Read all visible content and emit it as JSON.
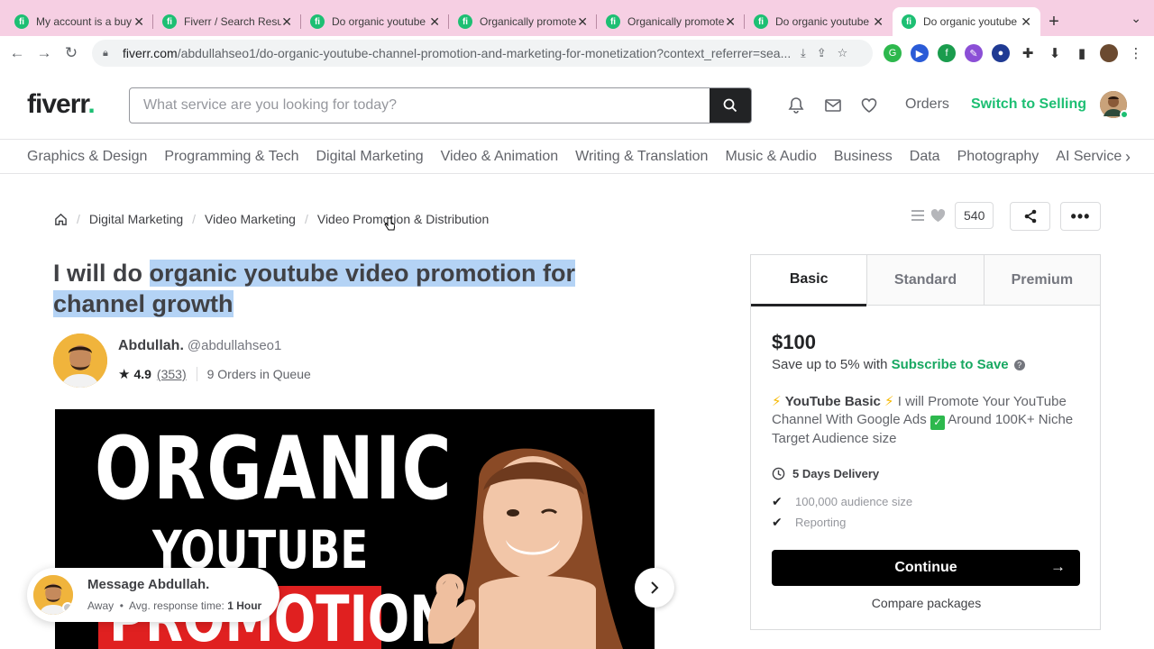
{
  "browser": {
    "tabs": [
      {
        "title": "My account is a buy"
      },
      {
        "title": "Fiverr / Search Resu"
      },
      {
        "title": "Do organic youtube"
      },
      {
        "title": "Organically promote"
      },
      {
        "title": "Organically promote"
      },
      {
        "title": "Do organic youtube"
      },
      {
        "title": "Do organic youtube"
      }
    ],
    "url_host": "fiverr.com",
    "url_path": "/abdullahseo1/do-organic-youtube-channel-promotion-and-marketing-for-monetization?context_referrer=sea..."
  },
  "header": {
    "logo": "fiverr",
    "search_placeholder": "What service are you looking for today?",
    "orders": "Orders",
    "switch": "Switch to Selling"
  },
  "categories": [
    "Graphics & Design",
    "Programming & Tech",
    "Digital Marketing",
    "Video & Animation",
    "Writing & Translation",
    "Music & Audio",
    "Business",
    "Data",
    "Photography",
    "AI Services"
  ],
  "breadcrumb": [
    "Digital Marketing",
    "Video Marketing",
    "Video Promotion & Distribution"
  ],
  "likes_count": "540",
  "gig": {
    "title_prefix": "I will do ",
    "title_highlight": "organic youtube video promotion for channel growth",
    "image_line1": "ORGANIC",
    "image_line2": "YOUTUBE",
    "image_line3": "PROMOTION"
  },
  "seller": {
    "name": "Abdullah.",
    "handle": "@abdullahseo1",
    "rating": "4.9",
    "reviews": "(353)",
    "queue": "9 Orders in Queue"
  },
  "message": {
    "title": "Message Abdullah.",
    "status": "Away",
    "response_label": "Avg. response time:",
    "response_time": "1 Hour"
  },
  "package": {
    "tabs": [
      "Basic",
      "Standard",
      "Premium"
    ],
    "price": "$100",
    "save_text": "Save up to 5% with",
    "save_link": "Subscribe to Save",
    "desc_title": "YouTube Basic",
    "desc_body": "I will Promote Your YouTube Channel With Google Ads",
    "desc_tail": "Around 100K+ Niche Target Audience size",
    "delivery": "5 Days Delivery",
    "features": [
      "100,000 audience size",
      "Reporting"
    ],
    "continue": "Continue",
    "compare": "Compare packages"
  },
  "colors": {
    "brand_green": "#1dbf73",
    "highlight": "#b4d3f5",
    "tabbar": "#f6cfe3"
  }
}
